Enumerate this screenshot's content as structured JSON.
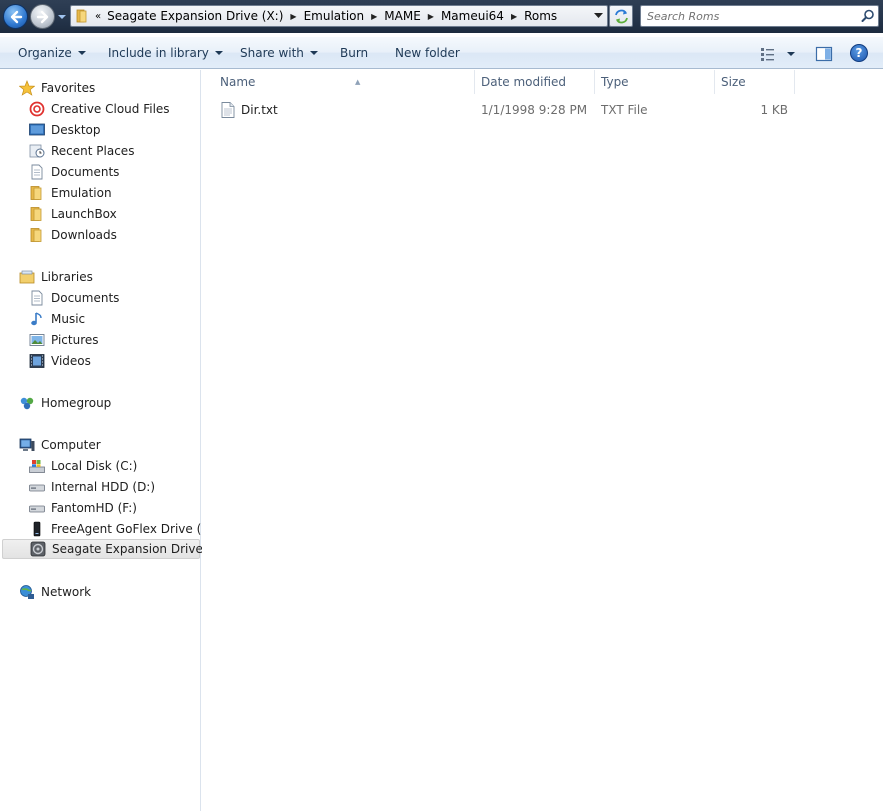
{
  "addressbar": {
    "breadcrumbs": [
      "Seagate Expansion Drive (X:)",
      "Emulation",
      "MAME",
      "Mameui64",
      "Roms"
    ],
    "overflow": "«"
  },
  "search": {
    "placeholder": "Search Roms"
  },
  "toolbar": {
    "organize": "Organize",
    "include_in_library": "Include in library",
    "share_with": "Share with",
    "burn": "Burn",
    "new_folder": "New folder",
    "help": "?"
  },
  "navigation": {
    "favorites": {
      "label": "Favorites",
      "items": [
        "Creative Cloud Files",
        "Desktop",
        "Recent Places",
        "Documents",
        "Emulation",
        "LaunchBox",
        "Downloads"
      ]
    },
    "libraries": {
      "label": "Libraries",
      "items": [
        "Documents",
        "Music",
        "Pictures",
        "Videos"
      ]
    },
    "homegroup": {
      "label": "Homegroup"
    },
    "computer": {
      "label": "Computer",
      "items": [
        "Local Disk (C:)",
        "Internal HDD (D:)",
        "FantomHD (F:)",
        "FreeAgent GoFlex Drive (I:)",
        "Seagate Expansion Drive (X:)"
      ],
      "selected": "Seagate Expansion Drive (X:)"
    },
    "network": {
      "label": "Network"
    }
  },
  "filelist": {
    "columns": {
      "name": "Name",
      "date": "Date modified",
      "type": "Type",
      "size": "Size"
    },
    "rows": [
      {
        "name": "Dir.txt",
        "date": "1/1/1998 9:28 PM",
        "type": "TXT File",
        "size": "1 KB"
      }
    ]
  },
  "colors": {
    "titlebar": "#24344a",
    "commandbar": "#e2edf9",
    "folder": "#f1c65a",
    "selection": "#e3e3e3",
    "header_text": "#4c607a"
  }
}
